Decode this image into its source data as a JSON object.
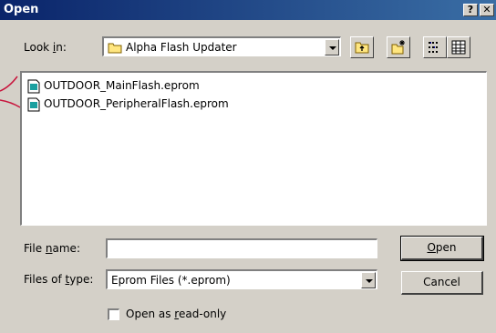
{
  "window": {
    "title": "Open",
    "help_label": "?",
    "close_label": "✕"
  },
  "look_in": {
    "label_pre": "Look ",
    "label_key": "i",
    "label_post": "n:",
    "value": "Alpha Flash Updater"
  },
  "toolbar": {
    "icons": [
      "up-one-level-icon",
      "new-folder-icon",
      "list-view-icon",
      "details-view-icon"
    ]
  },
  "files": [
    {
      "name": "OUTDOOR_MainFlash.eprom"
    },
    {
      "name": "OUTDOOR_PeripheralFlash.eprom"
    }
  ],
  "file_name": {
    "label_pre": "File ",
    "label_key": "n",
    "label_post": "ame:",
    "value": ""
  },
  "file_type": {
    "label_pre": "Files of ",
    "label_key": "t",
    "label_post": "ype:",
    "value": "Eprom Files (*.eprom)"
  },
  "read_only": {
    "label_pre": "Open as ",
    "label_key": "r",
    "label_post": "ead-only",
    "checked": false
  },
  "buttons": {
    "open_key": "O",
    "open_rest": "pen",
    "cancel": "Cancel"
  },
  "colors": {
    "titlebar": "#0a246a",
    "face": "#d4d0c8",
    "annotation": "#c8143c"
  }
}
